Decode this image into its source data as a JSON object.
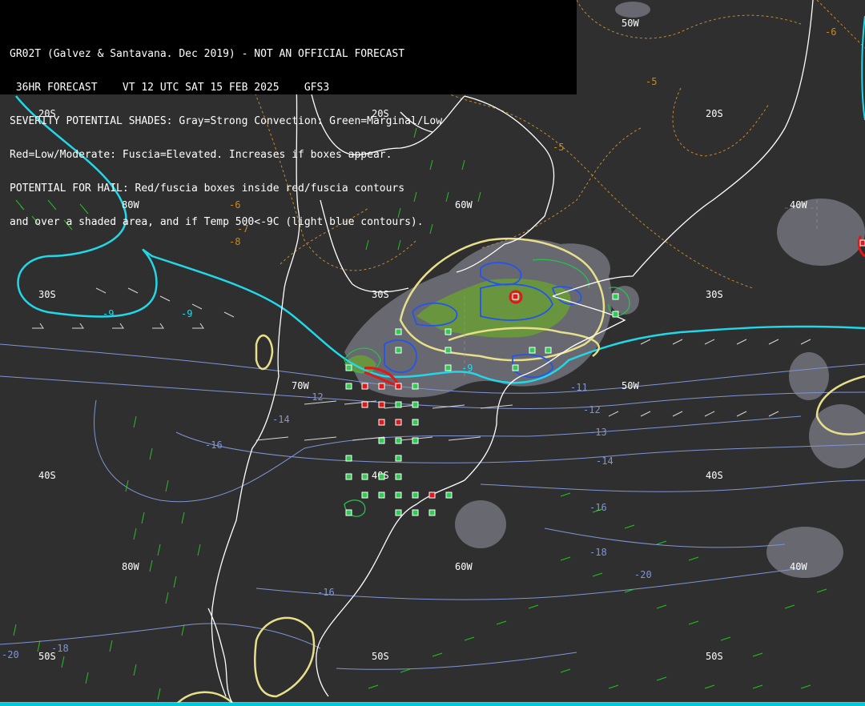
{
  "header": {
    "line1": "GR02T (Galvez & Santavana. Dec 2019) - NOT AN OFFICIAL FORECAST",
    "line2": " 36HR FORECAST    VT 12 UTC SAT 15 FEB 2025    GFS3",
    "line3": "SEVERITY POTENTIAL SHADES: Gray=Strong Convection: Green=Marginal/Low",
    "line4": "Red=Low/Moderate: Fuscia=Elevated. Increases if boxes appear.",
    "line5": "POTENTIAL FOR HAIL: Red/fuscia boxes inside red/fuscia contours",
    "line6": "and over a shaded area, and if Temp 500<-9C (light blue contours)."
  },
  "grid_labels": {
    "lat_20s": "20S",
    "lat_30s": "30S",
    "lat_40s": "40S",
    "lat_50s": "50S",
    "lon_80w": "80W",
    "lon_70w": "70W",
    "lon_60w": "60W",
    "lon_50w": "50W",
    "lon_40w": "40W"
  },
  "contour_labels": {
    "t_minus5": "-5",
    "t_minus6": "-6",
    "t_minus7": "-7",
    "t_minus8": "-8",
    "t_minus9": "-9",
    "t_minus11": "-11",
    "t_minus12": "-12",
    "t_minus13": "-13",
    "t_minus14": "-14",
    "t_minus16": "-16",
    "t_minus18": "-18",
    "t_minus20": "-20"
  },
  "colors": {
    "background": "#2f2f2f",
    "coast": "#ffffff",
    "cold_contour": "#22d8e8",
    "temp_contour": "#7f95d6",
    "warm_contour": "#c48a2a",
    "severity_green": "#6a9a3a",
    "severity_gray": "#6c6c74",
    "severity_line": "#e8df8a",
    "marginal_box": "#2ecc52",
    "moderate_box": "#e01818",
    "wind_green": "#1fc41f",
    "wind_white": "#d8d8d8"
  },
  "hail_boxes": {
    "marginal_count": 35,
    "moderate_count": 11
  }
}
